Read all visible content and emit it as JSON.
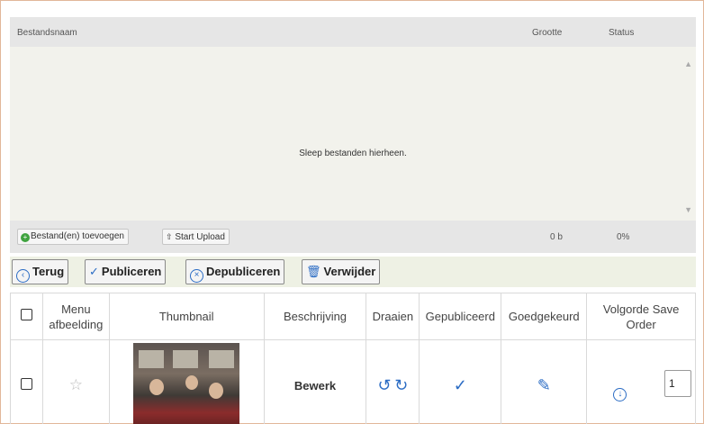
{
  "uploader": {
    "col_filename": "Bestandsnaam",
    "col_size": "Grootte",
    "col_status": "Status",
    "drop_text": "Sleep bestanden hierheen.",
    "add_files": "Bestand(en) toevoegen",
    "start_upload": "Start Upload",
    "total_size": "0 b",
    "total_percent": "0%"
  },
  "toolbar": {
    "back": "Terug",
    "publish": "Publiceren",
    "unpublish": "Depubliceren",
    "delete": "Verwijder"
  },
  "table": {
    "headers": {
      "menu_image": "Menu afbeelding",
      "thumbnail": "Thumbnail",
      "description": "Beschrijving",
      "rotate": "Draaien",
      "published": "Gepubliceerd",
      "approved": "Goedgekeurd",
      "order": "Volgorde Save Order"
    },
    "rows": [
      {
        "description": "Bewerk",
        "order": "1"
      }
    ]
  },
  "icons": {
    "add": "plus-circle-icon",
    "upload": "upload-arrow-icon",
    "back": "arrow-left-circle-icon",
    "publish": "check-icon",
    "unpublish": "x-circle-icon",
    "delete": "trash-icon",
    "menu_image": "star-icon",
    "rotate_left": "rotate-left-icon",
    "rotate_right": "rotate-right-icon",
    "published": "check-icon",
    "approved": "edit-icon",
    "order": "arrow-down-circle-icon"
  },
  "colors": {
    "accent": "#2b6cc4",
    "toolbar_bg": "#eef1e4",
    "frame_border": "#e2b79a"
  }
}
